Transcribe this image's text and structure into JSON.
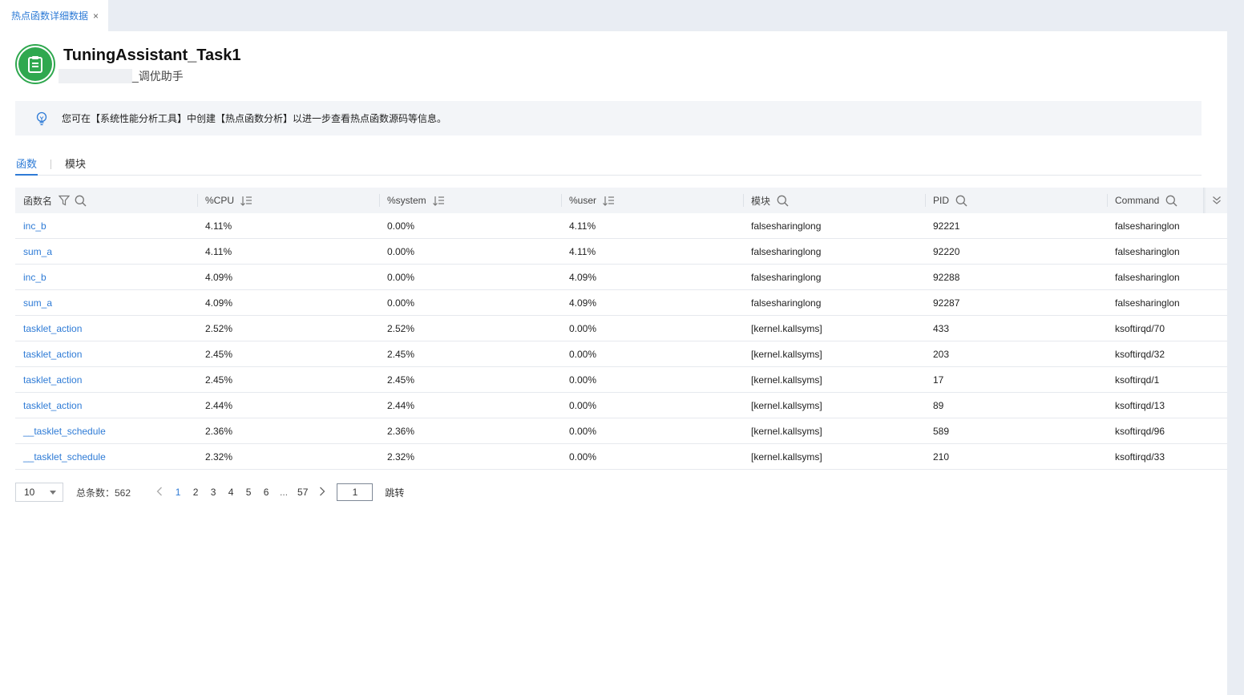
{
  "tab": {
    "label": "热点函数详细数据",
    "close": "×"
  },
  "header": {
    "title": "TuningAssistant_Task1",
    "subtitle": "_调优助手"
  },
  "notice": {
    "text": "您可在【系统性能分析工具】中创建【热点函数分析】以进一步查看热点函数源码等信息。"
  },
  "tabs": [
    {
      "label": "函数",
      "active": true
    },
    {
      "label": "模块",
      "active": false
    }
  ],
  "table": {
    "columns": [
      "函数名",
      "%CPU",
      "%system",
      "%user",
      "模块",
      "PID",
      "Command"
    ],
    "rows": [
      [
        "inc_b",
        "4.11%",
        "0.00%",
        "4.11%",
        "falsesharinglong",
        "92221",
        "falsesharinglon"
      ],
      [
        "sum_a",
        "4.11%",
        "0.00%",
        "4.11%",
        "falsesharinglong",
        "92220",
        "falsesharinglon"
      ],
      [
        "inc_b",
        "4.09%",
        "0.00%",
        "4.09%",
        "falsesharinglong",
        "92288",
        "falsesharinglon"
      ],
      [
        "sum_a",
        "4.09%",
        "0.00%",
        "4.09%",
        "falsesharinglong",
        "92287",
        "falsesharinglon"
      ],
      [
        "tasklet_action",
        "2.52%",
        "2.52%",
        "0.00%",
        "[kernel.kallsyms]",
        "433",
        "ksoftirqd/70"
      ],
      [
        "tasklet_action",
        "2.45%",
        "2.45%",
        "0.00%",
        "[kernel.kallsyms]",
        "203",
        "ksoftirqd/32"
      ],
      [
        "tasklet_action",
        "2.45%",
        "2.45%",
        "0.00%",
        "[kernel.kallsyms]",
        "17",
        "ksoftirqd/1"
      ],
      [
        "tasklet_action",
        "2.44%",
        "2.44%",
        "0.00%",
        "[kernel.kallsyms]",
        "89",
        "ksoftirqd/13"
      ],
      [
        "__tasklet_schedule",
        "2.36%",
        "2.36%",
        "0.00%",
        "[kernel.kallsyms]",
        "589",
        "ksoftirqd/96"
      ],
      [
        "__tasklet_schedule",
        "2.32%",
        "2.32%",
        "0.00%",
        "[kernel.kallsyms]",
        "210",
        "ksoftirqd/33"
      ]
    ]
  },
  "pagination": {
    "page_size": "10",
    "total_label": "总条数：562",
    "pages": [
      "1",
      "2",
      "3",
      "4",
      "5",
      "6"
    ],
    "dots": "...",
    "last_page": "57",
    "jump_value": "1",
    "jump_label": "跳转"
  },
  "colors": {
    "accent": "#2e7bd6",
    "logo_green": "#2fa84f"
  }
}
